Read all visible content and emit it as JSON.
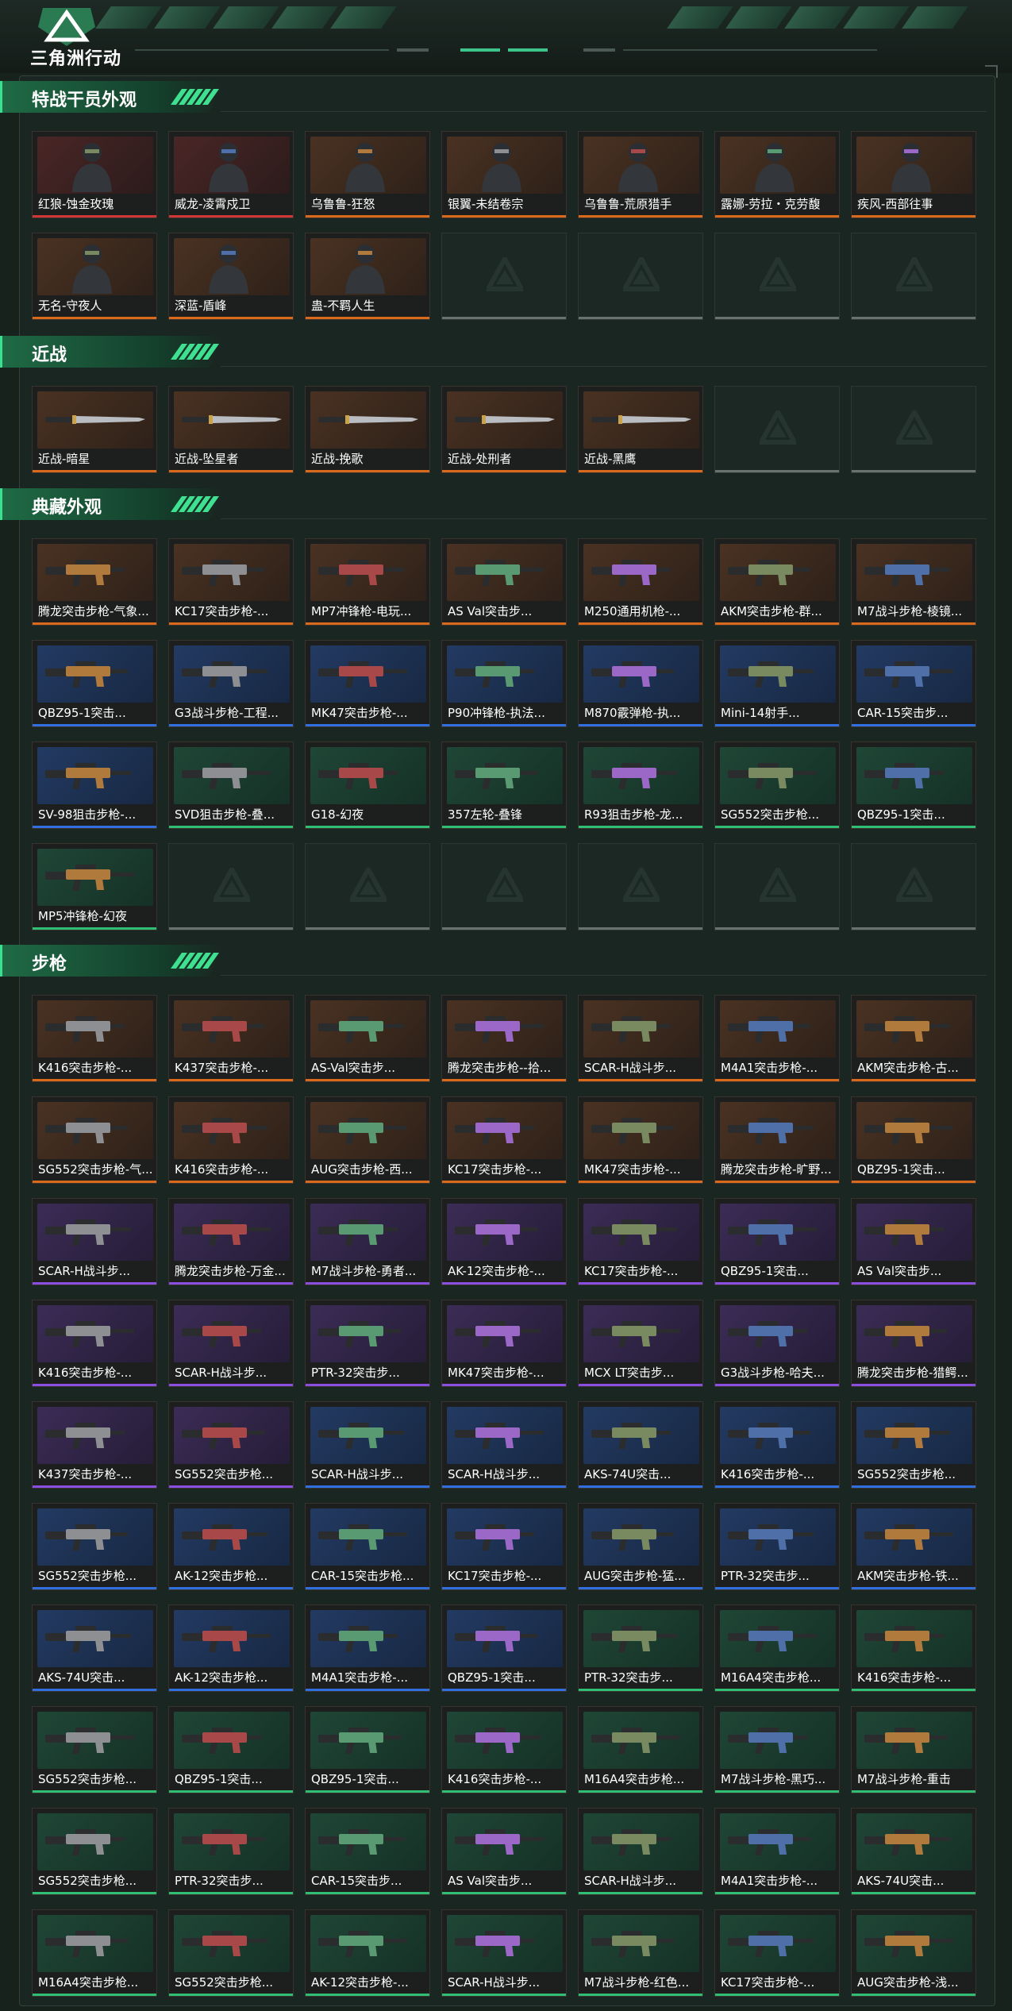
{
  "app": {
    "logo_text": "三角洲行动"
  },
  "sections": [
    {
      "title": "特战干员外观",
      "kind": "agent",
      "rows": [
        [
          {
            "label": "红狼-蚀金玫瑰",
            "rarity": "red"
          },
          {
            "label": "威龙-凌霄戍卫",
            "rarity": "red"
          },
          {
            "label": "乌鲁鲁-狂怒",
            "rarity": "orange"
          },
          {
            "label": "银翼-未结卷宗",
            "rarity": "orange"
          },
          {
            "label": "乌鲁鲁-荒原猎手",
            "rarity": "orange"
          },
          {
            "label": "露娜-劳拉・克劳馥",
            "rarity": "orange"
          },
          {
            "label": "疾风-西部往事",
            "rarity": "orange"
          }
        ],
        [
          {
            "label": "无名-守夜人",
            "rarity": "orange"
          },
          {
            "label": "深蓝-盾峰",
            "rarity": "orange"
          },
          {
            "label": "蛊-不羁人生",
            "rarity": "orange"
          },
          {
            "label": "",
            "rarity": "empty"
          },
          {
            "label": "",
            "rarity": "empty"
          },
          {
            "label": "",
            "rarity": "empty"
          },
          {
            "label": "",
            "rarity": "empty"
          }
        ]
      ]
    },
    {
      "title": "近战",
      "kind": "knife",
      "rows": [
        [
          {
            "label": "近战-暗星",
            "rarity": "orange"
          },
          {
            "label": "近战-坠星者",
            "rarity": "orange"
          },
          {
            "label": "近战-挽歌",
            "rarity": "orange"
          },
          {
            "label": "近战-处刑者",
            "rarity": "orange"
          },
          {
            "label": "近战-黑鹰",
            "rarity": "orange"
          },
          {
            "label": "",
            "rarity": "empty"
          },
          {
            "label": "",
            "rarity": "empty"
          }
        ]
      ]
    },
    {
      "title": "典藏外观",
      "kind": "gun",
      "rows": [
        [
          {
            "label": "腾龙突击步枪-气象...",
            "rarity": "orange"
          },
          {
            "label": "KC17突击步枪-...",
            "rarity": "orange"
          },
          {
            "label": "MP7冲锋枪-电玩...",
            "rarity": "orange"
          },
          {
            "label": "AS Val突击步...",
            "rarity": "orange"
          },
          {
            "label": "M250通用机枪-...",
            "rarity": "orange"
          },
          {
            "label": "AKM突击步枪-群...",
            "rarity": "orange"
          },
          {
            "label": "M7战斗步枪-棱镜...",
            "rarity": "orange"
          }
        ],
        [
          {
            "label": "QBZ95-1突击...",
            "rarity": "blue"
          },
          {
            "label": "G3战斗步枪-工程...",
            "rarity": "blue"
          },
          {
            "label": "MK47突击步枪-...",
            "rarity": "blue"
          },
          {
            "label": "P90冲锋枪-执法...",
            "rarity": "blue"
          },
          {
            "label": "M870霰弹枪-执...",
            "rarity": "blue"
          },
          {
            "label": "Mini-14射手...",
            "rarity": "blue"
          },
          {
            "label": "CAR-15突击步...",
            "rarity": "blue"
          }
        ],
        [
          {
            "label": "SV-98狙击步枪-...",
            "rarity": "blue"
          },
          {
            "label": "SVD狙击步枪-叠...",
            "rarity": "green"
          },
          {
            "label": "G18-幻夜",
            "rarity": "green"
          },
          {
            "label": "357左轮-叠锋",
            "rarity": "green"
          },
          {
            "label": "R93狙击步枪-龙...",
            "rarity": "green"
          },
          {
            "label": "SG552突击步枪...",
            "rarity": "green"
          },
          {
            "label": "QBZ95-1突击...",
            "rarity": "green"
          }
        ],
        [
          {
            "label": "MP5冲锋枪-幻夜",
            "rarity": "green"
          },
          {
            "label": "",
            "rarity": "empty"
          },
          {
            "label": "",
            "rarity": "empty"
          },
          {
            "label": "",
            "rarity": "empty"
          },
          {
            "label": "",
            "rarity": "empty"
          },
          {
            "label": "",
            "rarity": "empty"
          },
          {
            "label": "",
            "rarity": "empty"
          }
        ]
      ]
    },
    {
      "title": "步枪",
      "kind": "gun",
      "rows": [
        [
          {
            "label": "K416突击步枪-...",
            "rarity": "orange"
          },
          {
            "label": "K437突击步枪-...",
            "rarity": "orange"
          },
          {
            "label": "AS-Val突击步...",
            "rarity": "orange"
          },
          {
            "label": "腾龙突击步枪--拾...",
            "rarity": "orange"
          },
          {
            "label": "SCAR-H战斗步...",
            "rarity": "orange"
          },
          {
            "label": "M4A1突击步枪-...",
            "rarity": "orange"
          },
          {
            "label": "AKM突击步枪-古...",
            "rarity": "orange"
          }
        ],
        [
          {
            "label": "SG552突击步枪-气...",
            "rarity": "orange"
          },
          {
            "label": "K416突击步枪-...",
            "rarity": "orange"
          },
          {
            "label": "AUG突击步枪-西...",
            "rarity": "orange"
          },
          {
            "label": "KC17突击步枪-...",
            "rarity": "orange"
          },
          {
            "label": "MK47突击步枪-...",
            "rarity": "orange"
          },
          {
            "label": "腾龙突击步枪-旷野...",
            "rarity": "orange"
          },
          {
            "label": "QBZ95-1突击...",
            "rarity": "orange"
          }
        ],
        [
          {
            "label": "SCAR-H战斗步...",
            "rarity": "purple"
          },
          {
            "label": "腾龙突击步枪-万金...",
            "rarity": "purple"
          },
          {
            "label": "M7战斗步枪-勇者...",
            "rarity": "purple"
          },
          {
            "label": "AK-12突击步枪-...",
            "rarity": "purple"
          },
          {
            "label": "KC17突击步枪-...",
            "rarity": "purple"
          },
          {
            "label": "QBZ95-1突击...",
            "rarity": "purple"
          },
          {
            "label": "AS Val突击步...",
            "rarity": "purple"
          }
        ],
        [
          {
            "label": "K416突击步枪-...",
            "rarity": "purple"
          },
          {
            "label": "SCAR-H战斗步...",
            "rarity": "purple"
          },
          {
            "label": "PTR-32突击步...",
            "rarity": "purple"
          },
          {
            "label": "MK47突击步枪-...",
            "rarity": "purple"
          },
          {
            "label": "MCX LT突击步...",
            "rarity": "purple"
          },
          {
            "label": "G3战斗步枪-哈夫...",
            "rarity": "purple"
          },
          {
            "label": "腾龙突击步枪-猎鳄...",
            "rarity": "purple"
          }
        ],
        [
          {
            "label": "K437突击步枪-...",
            "rarity": "purple"
          },
          {
            "label": "SG552突击步枪...",
            "rarity": "purple"
          },
          {
            "label": "SCAR-H战斗步...",
            "rarity": "blue"
          },
          {
            "label": "SCAR-H战斗步...",
            "rarity": "blue"
          },
          {
            "label": "AKS-74U突击...",
            "rarity": "blue"
          },
          {
            "label": "K416突击步枪-...",
            "rarity": "blue"
          },
          {
            "label": "SG552突击步枪...",
            "rarity": "blue"
          }
        ],
        [
          {
            "label": "SG552突击步枪...",
            "rarity": "blue"
          },
          {
            "label": "AK-12突击步枪...",
            "rarity": "blue"
          },
          {
            "label": "CAR-15突击步枪...",
            "rarity": "blue"
          },
          {
            "label": "KC17突击步枪-...",
            "rarity": "blue"
          },
          {
            "label": "AUG突击步枪-猛...",
            "rarity": "blue"
          },
          {
            "label": "PTR-32突击步...",
            "rarity": "blue"
          },
          {
            "label": "AKM突击步枪-铁...",
            "rarity": "blue"
          }
        ],
        [
          {
            "label": "AKS-74U突击...",
            "rarity": "blue"
          },
          {
            "label": "AK-12突击步枪...",
            "rarity": "blue"
          },
          {
            "label": "M4A1突击步枪-...",
            "rarity": "blue"
          },
          {
            "label": "QBZ95-1突击...",
            "rarity": "blue"
          },
          {
            "label": "PTR-32突击步...",
            "rarity": "green"
          },
          {
            "label": "M16A4突击步枪...",
            "rarity": "green"
          },
          {
            "label": "K416突击步枪-...",
            "rarity": "green"
          }
        ],
        [
          {
            "label": "SG552突击步枪...",
            "rarity": "green"
          },
          {
            "label": "QBZ95-1突击...",
            "rarity": "green"
          },
          {
            "label": "QBZ95-1突击...",
            "rarity": "green"
          },
          {
            "label": "K416突击步枪-...",
            "rarity": "green"
          },
          {
            "label": "M16A4突击步枪...",
            "rarity": "green"
          },
          {
            "label": "M7战斗步枪-黑巧...",
            "rarity": "green"
          },
          {
            "label": "M7战斗步枪-重击",
            "rarity": "green"
          }
        ],
        [
          {
            "label": "SG552突击步枪...",
            "rarity": "green"
          },
          {
            "label": "PTR-32突击步...",
            "rarity": "green"
          },
          {
            "label": "CAR-15突击步...",
            "rarity": "green"
          },
          {
            "label": "AS Val突击步...",
            "rarity": "green"
          },
          {
            "label": "SCAR-H战斗步...",
            "rarity": "green"
          },
          {
            "label": "M4A1突击步枪-...",
            "rarity": "green"
          },
          {
            "label": "AKS-74U突击...",
            "rarity": "green"
          }
        ],
        [
          {
            "label": "M16A4突击步枪...",
            "rarity": "green"
          },
          {
            "label": "SG552突击步枪...",
            "rarity": "green"
          },
          {
            "label": "AK-12突击步枪-...",
            "rarity": "green"
          },
          {
            "label": "SCAR-H战斗步...",
            "rarity": "green"
          },
          {
            "label": "M7战斗步枪-红色...",
            "rarity": "green"
          },
          {
            "label": "KC17突击步枪-...",
            "rarity": "green"
          },
          {
            "label": "AUG突击步枪-浅...",
            "rarity": "green"
          }
        ]
      ]
    }
  ],
  "colors": {
    "accent": "#3be08f",
    "orange": "#d96a1c",
    "red": "#d03636",
    "purple": "#8a4ee0",
    "blue": "#2f6fe0",
    "green": "#2fbf74",
    "empty": "#6a726e"
  },
  "icons": {
    "logo": "delta-triangle-logo-icon",
    "empty_slot": "delta-triangle-watermark-icon"
  }
}
